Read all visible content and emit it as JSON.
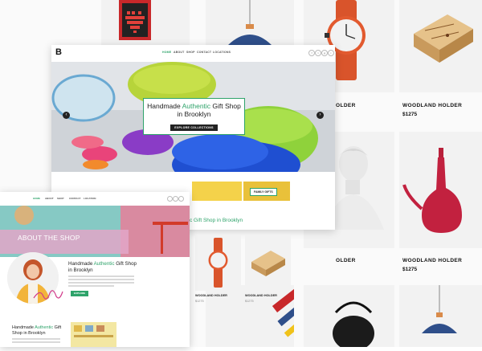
{
  "background_products": [
    {
      "title": "",
      "price": ""
    },
    {
      "title": "",
      "price": ""
    },
    {
      "title": "WOODLAND HOLDER",
      "price": "$1275"
    },
    {
      "title": "OLDER",
      "price": ""
    },
    {
      "title": "WOODLAND HOLDER",
      "price": "$1275"
    },
    {
      "title": "OLDER",
      "price": ""
    },
    {
      "title": "WOODLAND HOLDER",
      "price": "$1275"
    }
  ],
  "main": {
    "logo": "B",
    "nav": [
      "HOME",
      "ABOUT",
      "SHOP",
      "CONTACT",
      "LOCATIONS"
    ],
    "social": [
      "f",
      "t",
      "g",
      "i"
    ],
    "hero": {
      "title_pre": "Handmade ",
      "title_accent": "Authentic",
      "title_post": " Gift Shop in Brooklyn",
      "button": "EXPLORE COLLECTIONS"
    },
    "family_gifts": "FAMILY GIFTS",
    "section_title": "c Gift Shop in Brooklyn",
    "products": [
      {
        "title": "WOODLAND HOLDER",
        "price": "$1275"
      },
      {
        "title": "WOODLAND HOLDER",
        "price": "$1275"
      }
    ]
  },
  "second": {
    "nav": [
      "HOME",
      "ABOUT",
      "SHOP",
      "CONTACT",
      "LOCATION"
    ],
    "about_title": "ABOUT THE SHOP",
    "block1": {
      "title_pre": "Handmade ",
      "title_accent": "Authentic",
      "title_post": " Gift Shop in Brooklyn",
      "button": "EXPLORE"
    },
    "block2": {
      "title_pre": "Handmade ",
      "title_accent": "Authentic",
      "title_post": " Gift Shop in Brooklyn"
    }
  },
  "colors": {
    "accent": "#2ea36a",
    "dark": "#222222"
  }
}
